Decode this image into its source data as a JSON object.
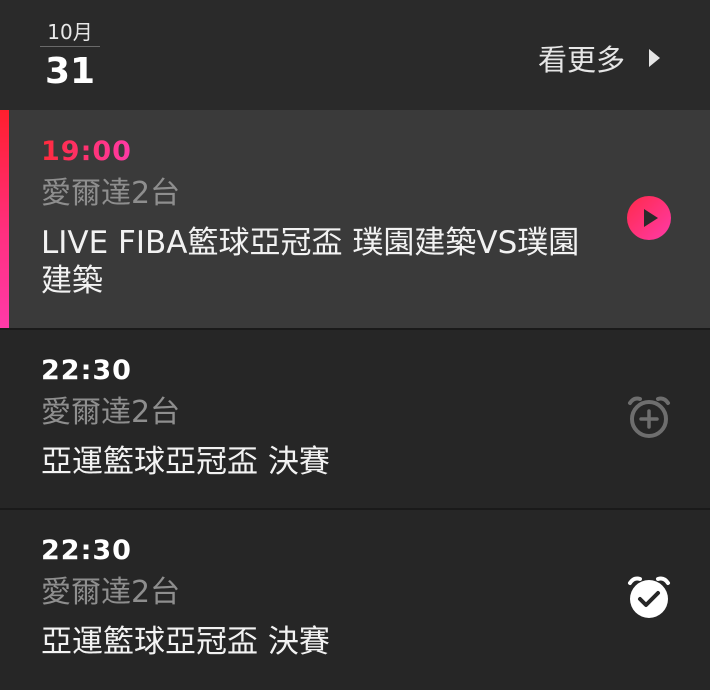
{
  "header": {
    "month": "10月",
    "day": "31",
    "see_more": "看更多"
  },
  "programs": [
    {
      "time": "19:00",
      "channel": "愛爾達2台",
      "title": "LIVE FIBA籃球亞冠盃 璞園建築VS璞園建築",
      "status": "live",
      "action_icon": "play-icon"
    },
    {
      "time": "22:30",
      "channel": "愛爾達2台",
      "title": "亞運籃球亞冠盃 決賽",
      "status": "upcoming",
      "action_icon": "alarm-add-icon"
    },
    {
      "time": "22:30",
      "channel": "愛爾達2台",
      "title": "亞運籃球亞冠盃 決賽",
      "status": "reminder-set",
      "action_icon": "alarm-check-icon"
    }
  ],
  "colors": {
    "live_accent_start": "#ff1f2d",
    "live_accent_end": "#ff3aa8",
    "background": "#262626",
    "live_row_background": "#3a3a3a",
    "muted_text": "#8e8e8e"
  }
}
